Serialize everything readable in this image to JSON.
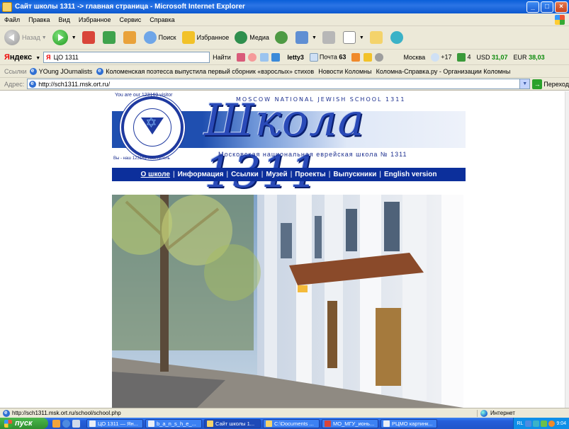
{
  "window": {
    "title": "Сайт школы 1311 -> главная страница - Microsoft Internet Explorer",
    "minimize": "_",
    "maximize": "□",
    "close": "×"
  },
  "menu": [
    "Файл",
    "Правка",
    "Вид",
    "Избранное",
    "Сервис",
    "Справка"
  ],
  "toolbar": {
    "back": "Назад",
    "search": "Поиск",
    "favorites": "Избранное",
    "media": "Медиа"
  },
  "yandex": {
    "brand_ya": "Я",
    "brand_rest": "ндекс",
    "search_value": "ЦО 1311",
    "find": "Найти",
    "user": "letty3",
    "mail": "Почта",
    "mail_count": "63",
    "city": "Москва",
    "temperature": "+17",
    "tv_count": "4",
    "usd_label": "USD",
    "usd_value": "31,07",
    "eur_label": "EUR",
    "eur_value": "38,03"
  },
  "links": {
    "label": "Ссылки",
    "items": [
      "YOung JOurnalists",
      "Коломенская поэтесса выпустила первый сборник «взрослых» стихов",
      "Новости Коломны",
      "Коломна-Справка.ру - Организации Коломны"
    ]
  },
  "address": {
    "label": "Адрес:",
    "url": "http://sch1311.msk.ort.ru/",
    "go": "Переход"
  },
  "site": {
    "visitor_en": "You are our 123169 visitor",
    "school_en": "MOSCOW NATIONAL JEWISH SCHOOL 1311",
    "school_big": "Школа 1311",
    "school_ru": "Московская национальная еврейская школа № 1311",
    "visitor_ru": "Вы - наш 123169 посетитель",
    "nav": [
      "О школе",
      "Информация",
      "Ссылки",
      "Музей",
      "Проекты",
      "Выпускники",
      "English version"
    ]
  },
  "status": {
    "url": "http://sch1311.msk.ort.ru/school/school.php",
    "zone": "Интернет"
  },
  "taskbar": {
    "start": "пуск",
    "tasks": [
      "ЦО 1311 — Ян...",
      "b_a_n_s_h_e_...",
      "Сайт школы 1...",
      "C:\\Documents ...",
      "МО_МГУ_ионь...",
      "РЦМО картинк..."
    ],
    "lang": "RL",
    "clock": "9:04"
  }
}
